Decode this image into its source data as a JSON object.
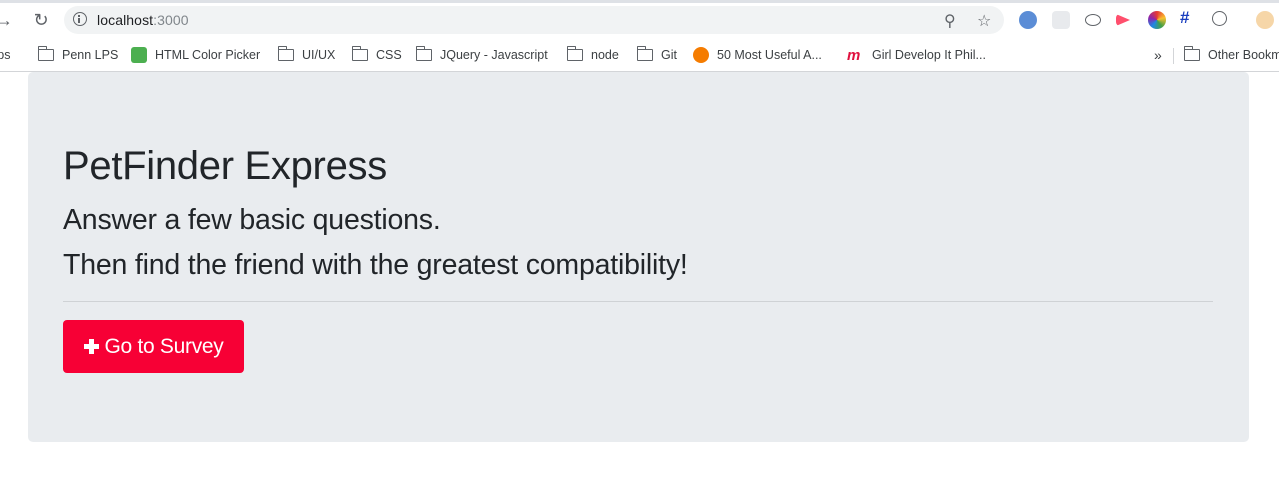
{
  "browser": {
    "url_host": "localhost",
    "url_port": ":3000",
    "bookmarks": [
      {
        "label": "Apps",
        "icon": "apps-grid-icon"
      },
      {
        "label": "Penn LPS",
        "icon": "folder-icon"
      },
      {
        "label": "HTML Color Picker",
        "icon": "w3schools-icon"
      },
      {
        "label": "UI/UX",
        "icon": "folder-icon"
      },
      {
        "label": "CSS",
        "icon": "folder-icon"
      },
      {
        "label": "JQuery - Javascript",
        "icon": "folder-icon"
      },
      {
        "label": "node",
        "icon": "folder-icon"
      },
      {
        "label": "Git",
        "icon": "folder-icon"
      },
      {
        "label": "50 Most Useful A...",
        "icon": "info-orange-icon"
      },
      {
        "label": "Girl Develop It Phil...",
        "icon": "meetup-icon"
      }
    ],
    "overflow_label": "»",
    "other_bookmarks_label": "Other Bookmarks"
  },
  "page": {
    "title": "PetFinder Express",
    "lead_1": "Answer a few basic questions.",
    "lead_2": "Then find the friend with the greatest compatibility!",
    "survey_button_label": "Go to Survey"
  },
  "colors": {
    "jumbotron_bg": "#e9ecef",
    "button_bg": "#f70035",
    "text": "#212529"
  }
}
